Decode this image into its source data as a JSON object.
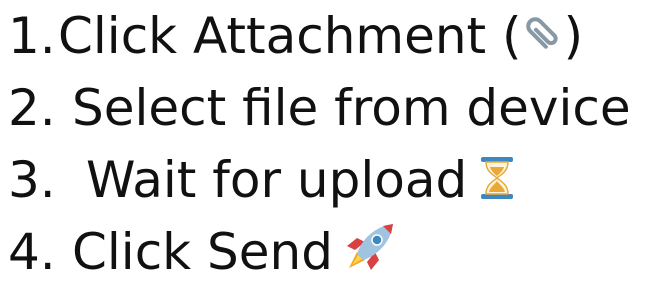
{
  "steps": [
    {
      "number": "1.",
      "text": "Click Attachment (",
      "suffix": ")",
      "icon": "paperclip-icon"
    },
    {
      "number": "2.",
      "text": "Select file from device"
    },
    {
      "number": "3.",
      "text": "Wait for upload",
      "icon": "hourglass-icon"
    },
    {
      "number": "4.",
      "text": "Click Send",
      "icon": "rocket-icon"
    }
  ],
  "colors": {
    "text": "#111111",
    "hourglass": "#e9a93a",
    "hourglass_frame": "#3b88c3",
    "rocket_body": "#a0c4e0",
    "rocket_fin": "#d84141",
    "flame": "#f5a623"
  }
}
